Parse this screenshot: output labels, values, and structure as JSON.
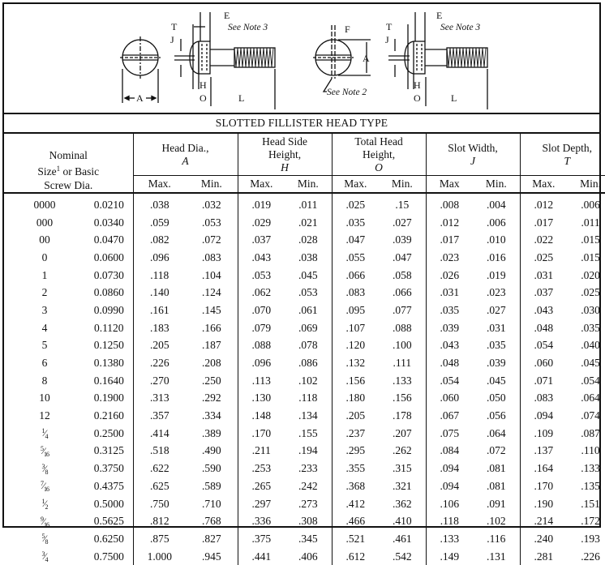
{
  "diagram": {
    "left_figure": {
      "labels": [
        "A",
        "T",
        "J",
        "E",
        "H",
        "O",
        "L"
      ],
      "note": "See Note 3"
    },
    "right_figure": {
      "labels": [
        "F",
        "A",
        "T",
        "J",
        "E",
        "H",
        "O",
        "L"
      ],
      "notes": [
        "See Note 2",
        "See Note 3"
      ]
    }
  },
  "table": {
    "title": "SLOTTED FILLISTER HEAD TYPE",
    "first_header": {
      "line1": "Nominal",
      "line2_pre": "Size",
      "line2_sup": "1",
      "line2_post": " or Basic",
      "line3": "Screw Dia."
    },
    "groups": [
      {
        "line1": "Head Dia.,",
        "line2": "",
        "symbol": "A",
        "max": "Max.",
        "min": "Min."
      },
      {
        "line1": "Head Side",
        "line2": "Height,",
        "symbol": "H",
        "max": "Max.",
        "min": "Min."
      },
      {
        "line1": "Total Head",
        "line2": "Height,",
        "symbol": "O",
        "max": "Max.",
        "min": "Min."
      },
      {
        "line1": "Slot Width,",
        "line2": "",
        "symbol": "J",
        "max": "Max",
        "min": "Min."
      },
      {
        "line1": "Slot Depth,",
        "line2": "",
        "symbol": "T",
        "max": "Max.",
        "min": "Min."
      }
    ],
    "rows": [
      {
        "size": "0000",
        "dia": "0.0210",
        "vals": [
          ".038",
          ".032",
          ".019",
          ".011",
          ".025",
          ".15",
          ".008",
          ".004",
          ".012",
          ".006"
        ]
      },
      {
        "size": "000",
        "dia": "0.0340",
        "vals": [
          ".059",
          ".053",
          ".029",
          ".021",
          ".035",
          ".027",
          ".012",
          ".006",
          ".017",
          ".011"
        ]
      },
      {
        "size": "00",
        "dia": "0.0470",
        "vals": [
          ".082",
          ".072",
          ".037",
          ".028",
          ".047",
          ".039",
          ".017",
          ".010",
          ".022",
          ".015"
        ]
      },
      {
        "size": "0",
        "dia": "0.0600",
        "vals": [
          ".096",
          ".083",
          ".043",
          ".038",
          ".055",
          ".047",
          ".023",
          ".016",
          ".025",
          ".015"
        ]
      },
      {
        "size": "1",
        "dia": "0.0730",
        "vals": [
          ".118",
          ".104",
          ".053",
          ".045",
          ".066",
          ".058",
          ".026",
          ".019",
          ".031",
          ".020"
        ]
      },
      {
        "size": "2",
        "dia": "0.0860",
        "vals": [
          ".140",
          ".124",
          ".062",
          ".053",
          ".083",
          ".066",
          ".031",
          ".023",
          ".037",
          ".025"
        ]
      },
      {
        "size": "3",
        "dia": "0.0990",
        "vals": [
          ".161",
          ".145",
          ".070",
          ".061",
          ".095",
          ".077",
          ".035",
          ".027",
          ".043",
          ".030"
        ]
      },
      {
        "size": "4",
        "dia": "0.1120",
        "vals": [
          ".183",
          ".166",
          ".079",
          ".069",
          ".107",
          ".088",
          ".039",
          ".031",
          ".048",
          ".035"
        ]
      },
      {
        "size": "5",
        "dia": "0.1250",
        "vals": [
          ".205",
          ".187",
          ".088",
          ".078",
          ".120",
          ".100",
          ".043",
          ".035",
          ".054",
          ".040"
        ]
      },
      {
        "size": "6",
        "dia": "0.1380",
        "vals": [
          ".226",
          ".208",
          ".096",
          ".086",
          ".132",
          ".111",
          ".048",
          ".039",
          ".060",
          ".045"
        ]
      },
      {
        "size": "8",
        "dia": "0.1640",
        "vals": [
          ".270",
          ".250",
          ".113",
          ".102",
          ".156",
          ".133",
          ".054",
          ".045",
          ".071",
          ".054"
        ]
      },
      {
        "size": "10",
        "dia": "0.1900",
        "vals": [
          ".313",
          ".292",
          ".130",
          ".118",
          ".180",
          ".156",
          ".060",
          ".050",
          ".083",
          ".064"
        ]
      },
      {
        "size": "12",
        "dia": "0.2160",
        "vals": [
          ".357",
          ".334",
          ".148",
          ".134",
          ".205",
          ".178",
          ".067",
          ".056",
          ".094",
          ".074"
        ]
      },
      {
        "size_num": "1",
        "size_den": "4",
        "dia": "0.2500",
        "vals": [
          ".414",
          ".389",
          ".170",
          ".155",
          ".237",
          ".207",
          ".075",
          ".064",
          ".109",
          ".087"
        ]
      },
      {
        "size_num": "5",
        "size_den": "16",
        "dia": "0.3125",
        "vals": [
          ".518",
          ".490",
          ".211",
          ".194",
          ".295",
          ".262",
          ".084",
          ".072",
          ".137",
          ".110"
        ]
      },
      {
        "size_num": "3",
        "size_den": "8",
        "dia": "0.3750",
        "vals": [
          ".622",
          ".590",
          ".253",
          ".233",
          ".355",
          ".315",
          ".094",
          ".081",
          ".164",
          ".133"
        ]
      },
      {
        "size_num": "7",
        "size_den": "16",
        "dia": "0.4375",
        "vals": [
          ".625",
          ".589",
          ".265",
          ".242",
          ".368",
          ".321",
          ".094",
          ".081",
          ".170",
          ".135"
        ]
      },
      {
        "size_num": "1",
        "size_den": "2",
        "dia": "0.5000",
        "vals": [
          ".750",
          ".710",
          ".297",
          ".273",
          ".412",
          ".362",
          ".106",
          ".091",
          ".190",
          ".151"
        ]
      },
      {
        "size_num": "9",
        "size_den": "16",
        "dia": "0.5625",
        "vals": [
          ".812",
          ".768",
          ".336",
          ".308",
          ".466",
          ".410",
          ".118",
          ".102",
          ".214",
          ".172"
        ]
      },
      {
        "size_num": "5",
        "size_den": "8",
        "dia": "0.6250",
        "vals": [
          ".875",
          ".827",
          ".375",
          ".345",
          ".521",
          ".461",
          ".133",
          ".116",
          ".240",
          ".193"
        ]
      },
      {
        "size_num": "3",
        "size_den": "4",
        "dia": "0.7500",
        "vals": [
          "1.000",
          ".945",
          ".441",
          ".406",
          ".612",
          ".542",
          ".149",
          ".131",
          ".281",
          ".226"
        ]
      }
    ]
  }
}
